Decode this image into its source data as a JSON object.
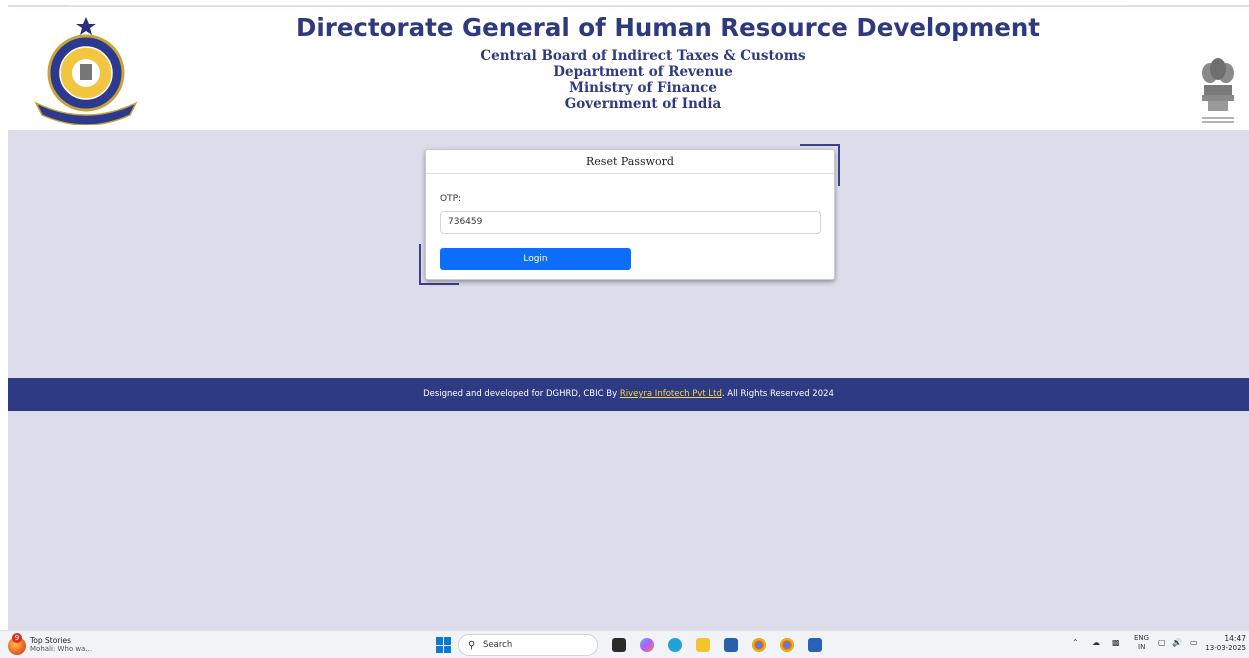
{
  "header": {
    "title": "Directorate General of Human Resource Development",
    "lines": [
      "Central Board of Indirect Taxes & Customs",
      "Department of Revenue",
      "Ministry of Finance",
      "Government of India"
    ],
    "left_emblem": "cbic-emblem",
    "right_emblem": "national-emblem",
    "emblem_motto": "सत्यमेव जयते"
  },
  "form": {
    "heading": "Reset Password",
    "otp_label": "OTP:",
    "otp_value": "736459",
    "login_label": "Login"
  },
  "footer": {
    "prefix": "Designed and developed for DGHRD, CBIC By ",
    "link_text": "Riveyra Infotech Pvt Ltd",
    "suffix": ". All Rights Reserved 2024"
  },
  "taskbar": {
    "news_badge": "9",
    "news_title": "Top Stories",
    "news_sub": "Mohali: Who wa...",
    "search_placeholder": "Search",
    "lang_top": "ENG",
    "lang_bottom": "IN",
    "time": "14:47",
    "date": "13-03-2025",
    "apps": [
      "file-explorer-icon",
      "copilot-icon",
      "edge-icon",
      "folder-icon",
      "store-icon",
      "chrome-icon",
      "chrome-alt-icon",
      "word-icon"
    ]
  },
  "colors": {
    "brand_navy": "#2f3a85",
    "page_bg": "#dcdcea",
    "button_blue": "#0d6efd",
    "footer_link": "#f3d64a"
  }
}
